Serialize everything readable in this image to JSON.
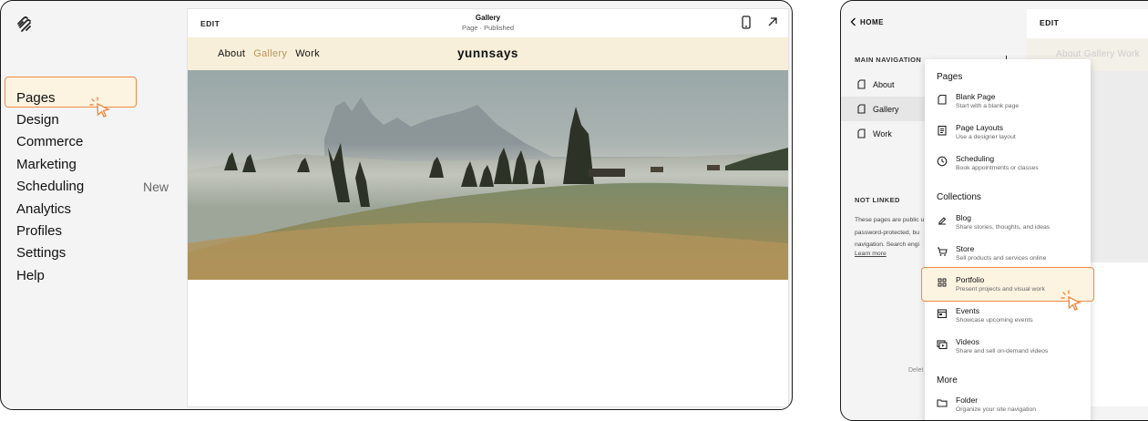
{
  "left": {
    "nav": [
      {
        "label": "Pages",
        "badge": ""
      },
      {
        "label": "Design",
        "badge": ""
      },
      {
        "label": "Commerce",
        "badge": ""
      },
      {
        "label": "Marketing",
        "badge": ""
      },
      {
        "label": "Scheduling",
        "badge": "New"
      },
      {
        "label": "Analytics",
        "badge": ""
      },
      {
        "label": "Profiles",
        "badge": ""
      },
      {
        "label": "Settings",
        "badge": ""
      },
      {
        "label": "Help",
        "badge": ""
      }
    ],
    "preview": {
      "edit_label": "EDIT",
      "page_title": "Gallery",
      "page_status": "Page · Published",
      "site_nav": [
        "About",
        "Gallery",
        "Work"
      ],
      "site_nav_active": "Gallery",
      "site_title": "yunnsays"
    }
  },
  "right": {
    "back_label": "HOME",
    "main_nav_label": "MAIN NAVIGATION",
    "pages": [
      "About",
      "Gallery",
      "Work"
    ],
    "selected_page": "Gallery",
    "not_linked_label": "NOT LINKED",
    "not_linked_lines": [
      "These pages are public u",
      "password-protected, bu",
      "navigation. Search engi"
    ],
    "learn_more": "Learn more",
    "delete_label": "Delet",
    "preview": {
      "edit_label": "EDIT",
      "nav_text": "About  Gallery  Work"
    },
    "menu": {
      "sections": [
        {
          "heading": "Pages",
          "items": [
            {
              "title": "Blank Page",
              "desc": "Start with a blank page",
              "icon": "blank-page-icon"
            },
            {
              "title": "Page Layouts",
              "desc": "Use a designer layout",
              "icon": "page-layouts-icon"
            },
            {
              "title": "Scheduling",
              "desc": "Book appointments or classes",
              "icon": "clock-icon"
            }
          ]
        },
        {
          "heading": "Collections",
          "items": [
            {
              "title": "Blog",
              "desc": "Share stories, thoughts, and ideas",
              "icon": "blog-icon"
            },
            {
              "title": "Store",
              "desc": "Sell products and services online",
              "icon": "cart-icon"
            },
            {
              "title": "Portfolio",
              "desc": "Present projects and visual work",
              "icon": "grid-icon"
            },
            {
              "title": "Events",
              "desc": "Showcase upcoming events",
              "icon": "calendar-icon"
            },
            {
              "title": "Videos",
              "desc": "Share and sell on-demand videos",
              "icon": "video-icon"
            }
          ]
        },
        {
          "heading": "More",
          "items": [
            {
              "title": "Folder",
              "desc": "Organize your site navigation",
              "icon": "folder-icon"
            }
          ]
        }
      ]
    }
  },
  "colors": {
    "accent": "#f08a43",
    "highlight": "#fdf3e1",
    "site_header": "#f7efd9",
    "nav_active": "#b8955d"
  }
}
